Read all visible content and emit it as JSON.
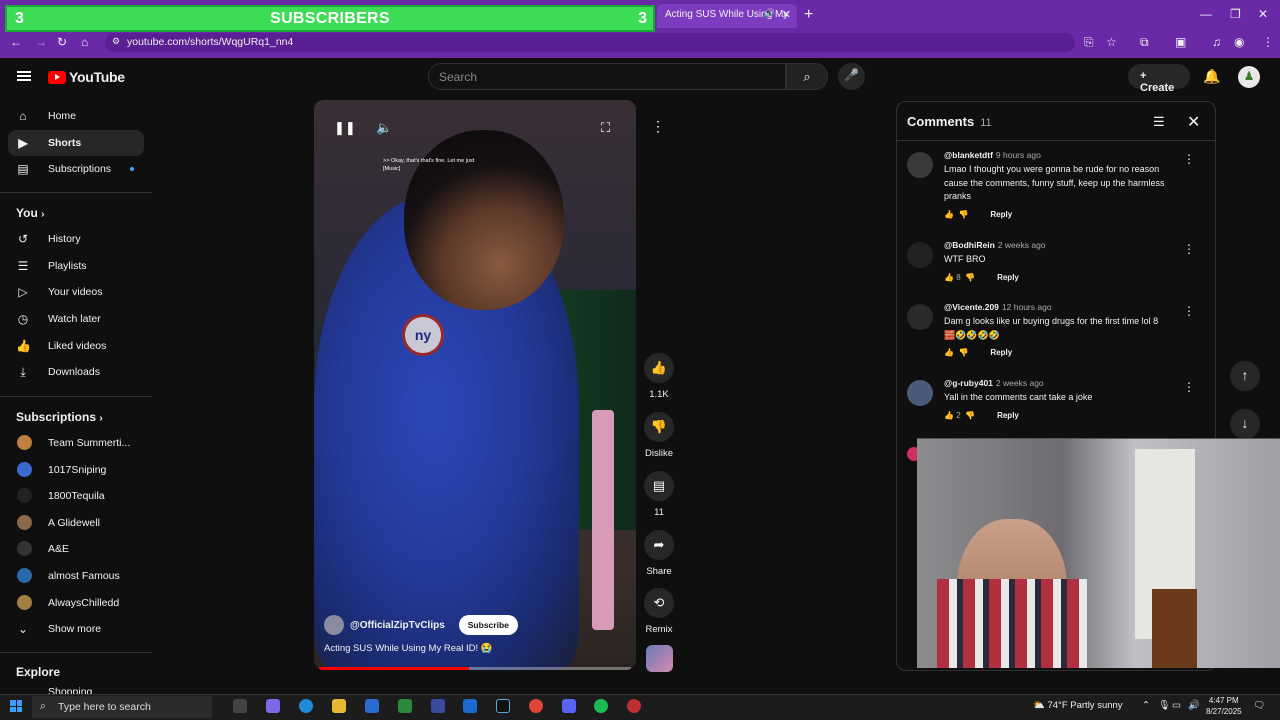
{
  "browser": {
    "banner": {
      "left_num": "3",
      "title": "SUBSCRIBERS",
      "right_num": "3"
    },
    "tab_title": "Acting SUS While Using My",
    "url": "youtube.com/shorts/WqgURq1_nn4"
  },
  "header": {
    "logo": "YouTube",
    "search_placeholder": "Search",
    "create_label": "Create",
    "avatar_letter": "♟"
  },
  "sidebar": {
    "main": [
      {
        "label": "Home",
        "icon": "home-icon"
      },
      {
        "label": "Shorts",
        "icon": "shorts-icon"
      },
      {
        "label": "Subscriptions",
        "icon": "subscriptions-icon"
      }
    ],
    "you_title": "You",
    "you": [
      {
        "label": "History"
      },
      {
        "label": "Playlists"
      },
      {
        "label": "Your videos"
      },
      {
        "label": "Watch later"
      },
      {
        "label": "Liked videos"
      },
      {
        "label": "Downloads"
      }
    ],
    "subs_title": "Subscriptions",
    "subs": [
      {
        "label": "Team Summerti...",
        "color": "#c08040"
      },
      {
        "label": "1017Sniping",
        "color": "#3a6ad0"
      },
      {
        "label": "1800Tequila",
        "color": "#222222"
      },
      {
        "label": "A Glidewell",
        "color": "#8a6a4a"
      },
      {
        "label": "A&E",
        "color": "#333333"
      },
      {
        "label": "almost Famous",
        "color": "#2a6aaa"
      },
      {
        "label": "AlwaysChilledd",
        "color": "#a08040"
      }
    ],
    "show_more": "Show more",
    "explore_title": "Explore",
    "explore_next": "Shopping"
  },
  "video": {
    "caption": ">> Okay, that's that's fine. Let me just [Music]",
    "jersey_logo": "ny",
    "channel": "@OfficialZipTvClips",
    "subscribe": "Subscribe",
    "title": "Acting SUS While Using My Real ID! 😭",
    "progress_fraction": 0.48
  },
  "actions": {
    "likes": "1.1K",
    "dislike": "Dislike",
    "comments": "11",
    "share": "Share",
    "remix": "Remix"
  },
  "comments": {
    "title": "Comments",
    "count": "11",
    "reply": "Reply",
    "items": [
      {
        "author": "@blanketdtf",
        "time": "9 hours ago",
        "text": "Lmao I thought you were gonna be rude for no reason cause the comments, funny stuff, keep up the harmless pranks",
        "likes": "",
        "color": "#3a3a3a"
      },
      {
        "author": "@BodhiRein",
        "time": "2 weeks ago",
        "text": "WTF BRO",
        "likes": "8",
        "color": "#222222"
      },
      {
        "author": "@Vicente.209",
        "time": "12 hours ago",
        "text": "Dam g looks like ur buying drugs for the first time lol 8 🧱🤣🤣🤣🤣",
        "likes": "",
        "color": "#2a2a2a"
      },
      {
        "author": "@g-ruby401",
        "time": "2 weeks ago",
        "text": "Yall in the comments cant take a joke",
        "likes": "2",
        "color": "#4a5a7a"
      }
    ]
  },
  "taskbar": {
    "search": "Type here to search",
    "weather": "74°F  Partly sunny",
    "time": "4:47 PM",
    "date": "8/27/2025"
  }
}
